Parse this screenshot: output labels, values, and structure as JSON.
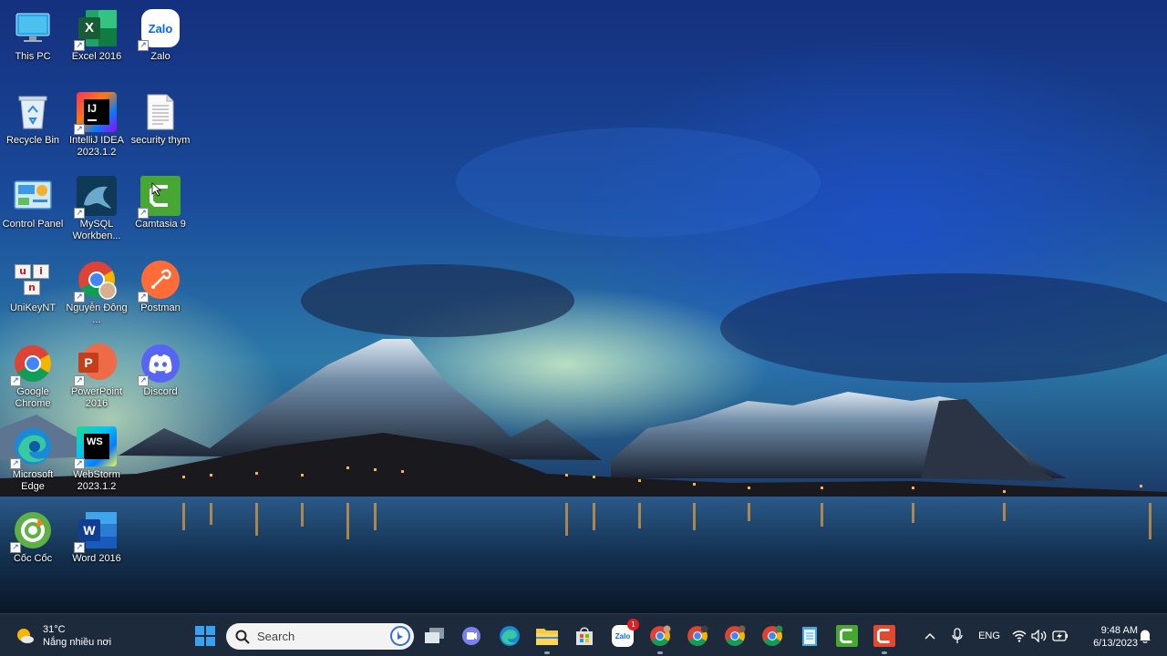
{
  "desktop": {
    "icons": [
      {
        "id": "this-pc",
        "label": "This PC",
        "icon": "monitor-icon"
      },
      {
        "id": "excel",
        "label": "Excel 2016",
        "icon": "excel-icon"
      },
      {
        "id": "zalo",
        "label": "Zalo",
        "icon": "zalo-icon"
      },
      {
        "id": "recycle",
        "label": "Recycle Bin",
        "icon": "recycle-bin-icon"
      },
      {
        "id": "intellij",
        "label": "IntelliJ IDEA 2023.1.2",
        "icon": "intellij-icon",
        "glyph": "IJ"
      },
      {
        "id": "security",
        "label": "security thym",
        "icon": "document-icon"
      },
      {
        "id": "control",
        "label": "Control Panel",
        "icon": "control-panel-icon"
      },
      {
        "id": "mysql",
        "label": "MySQL Workben...",
        "icon": "mysql-dolphin-icon"
      },
      {
        "id": "camtasia",
        "label": "Camtasia 9",
        "icon": "camtasia-icon"
      },
      {
        "id": "unikey",
        "label": "UniKeyNT",
        "icon": "unikey-icon",
        "glyphs": [
          "u",
          "i",
          "n"
        ]
      },
      {
        "id": "chrome-nguyen",
        "label": "Nguyễn Đông ...",
        "icon": "chrome-profile-icon"
      },
      {
        "id": "postman",
        "label": "Postman",
        "icon": "postman-icon"
      },
      {
        "id": "chrome",
        "label": "Google Chrome",
        "icon": "chrome-icon"
      },
      {
        "id": "powerpoint",
        "label": "PowerPoint 2016",
        "icon": "powerpoint-icon",
        "glyph": "P"
      },
      {
        "id": "discord",
        "label": "Discord",
        "icon": "discord-icon"
      },
      {
        "id": "edge",
        "label": "Microsoft Edge",
        "icon": "edge-icon"
      },
      {
        "id": "webstorm",
        "label": "WebStorm 2023.1.2",
        "icon": "webstorm-icon",
        "glyph": "WS"
      },
      {
        "id": "coccoc",
        "label": "Cốc Cốc",
        "icon": "coccoc-icon"
      },
      {
        "id": "word",
        "label": "Word 2016",
        "icon": "word-icon",
        "glyph": "W"
      }
    ],
    "shortcut_glyph": "↗",
    "zalo_glyph": "Zalo",
    "excel_glyph": "X"
  },
  "taskbar": {
    "weather": {
      "temp": "31°C",
      "desc": "Nắng nhiều nơi"
    },
    "search": {
      "placeholder": "Search"
    },
    "zalo_badge": "1",
    "zalo_glyph": "Zalo",
    "language": "ENG",
    "clock": {
      "time": "9:48 AM",
      "date": "6/13/2023"
    }
  },
  "colors": {
    "taskbar_bg": "#1c2a3c",
    "accent": "#0078d4"
  }
}
